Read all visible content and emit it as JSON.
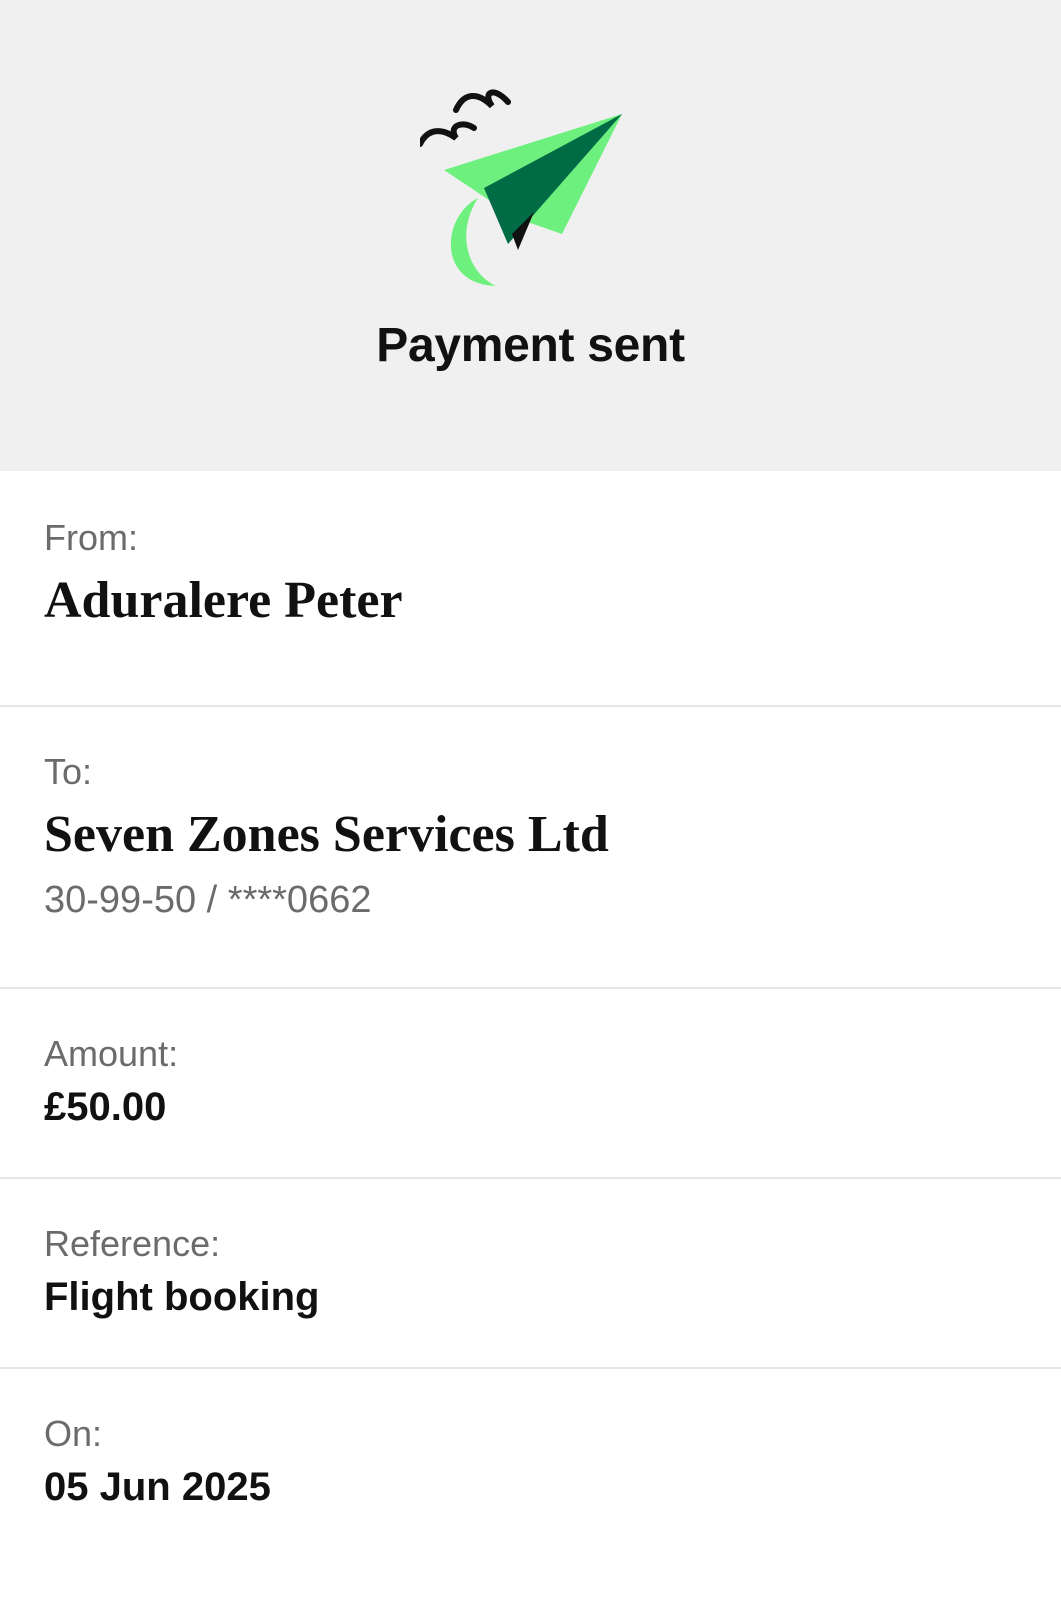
{
  "header": {
    "title": "Payment sent",
    "illustration": "paper-plane-icon",
    "accent_color": "#6ef07f",
    "dark_green": "#006b44"
  },
  "details": {
    "from": {
      "label": "From:",
      "value": "Aduralere Peter"
    },
    "to": {
      "label": "To:",
      "value": "Seven Zones Services Ltd",
      "account": "30-99-50 / ****0662"
    },
    "amount": {
      "label": "Amount:",
      "value": "£50.00"
    },
    "reference": {
      "label": "Reference:",
      "value": "Flight booking"
    },
    "on": {
      "label": "On:",
      "value": "05 Jun 2025"
    }
  }
}
